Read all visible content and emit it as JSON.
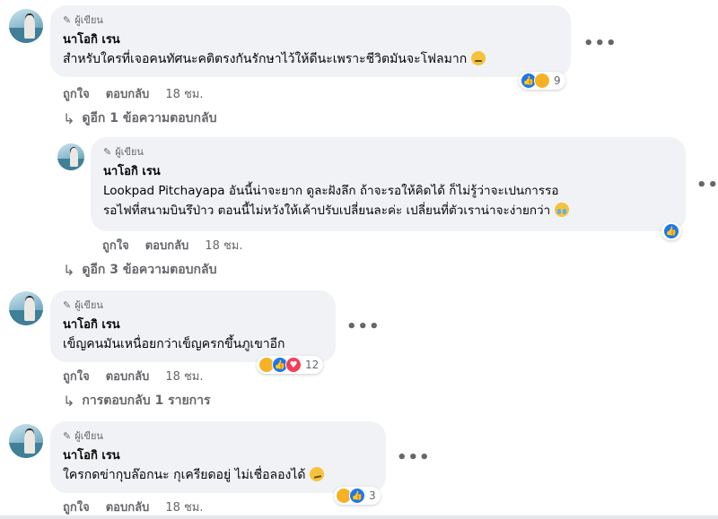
{
  "comments": [
    {
      "badge": "ผู้เขียน",
      "author": "นาโอกิ เรน",
      "text": "สำหรับใครที่เจอคนทัศนะคติตรงกันรักษาไว้ให้ดีนะเพราะชีวิตมันจะโฟลมาก",
      "emoji": "pensive-face",
      "reactions": {
        "icons": [
          "like-icon",
          "care-icon"
        ],
        "count": "9"
      },
      "like_label": "ถูกใจ",
      "reply_label": "ตอบกลับ",
      "time": "18 ชม.",
      "view_replies": "ดูอีก 1 ข้อความตอบกลับ"
    },
    {
      "badge": "ผู้เขียน",
      "author": "นาโอกิ เรน",
      "text_line1": "Lookpad Pitchayapa อันนี้น่าจะยาก ดูละฝังลึก ถ้าจะรอให้คิดได้ ก็ไม่รู้ว่าจะเปนการรอ",
      "text_line2": "รอไฟที่สนามบินรึป่าว ตอนนี้ไม่หวังให้เค้าปรับเปลี่ยนละค่ะ เปลี่ยนที่ตัวเราน่าจะง่ายกว่า",
      "emoji": "crying-face",
      "reactions": {
        "icons": [
          "like-icon"
        ],
        "count": ""
      },
      "like_label": "ถูกใจ",
      "reply_label": "ตอบกลับ",
      "time": "18 ชม.",
      "view_replies": "ดูอีก 3 ข้อความตอบกลับ"
    },
    {
      "badge": "ผู้เขียน",
      "author": "นาโอกิ เรน",
      "text": "เข็ญคนมันเหนื่อยกว่าเข็ญครกขึ้นภูเขาอีก",
      "reactions": {
        "icons": [
          "care-icon",
          "like-icon",
          "love-icon"
        ],
        "count": "12"
      },
      "like_label": "ถูกใจ",
      "reply_label": "ตอบกลับ",
      "time": "18 ชม.",
      "view_replies": "การตอบกลับ 1 รายการ"
    },
    {
      "badge": "ผู้เขียน",
      "author": "นาโอกิ เรน",
      "text": "ใครกดข่ากุบล๊อกนะ กุเครียดอยู่ ไม่เชื่อลองได้",
      "emoji": "smirking-face",
      "reactions": {
        "icons": [
          "care-icon",
          "like-icon"
        ],
        "count": "3"
      },
      "like_label": "ถูกใจ",
      "reply_label": "ตอบกลับ",
      "time": "18 ชม."
    }
  ],
  "more_glyph": "•••",
  "colors": {
    "like": "#1877f2",
    "love": "#f33e58",
    "care": "#f7b125",
    "bubble": "#f0f2f5",
    "meta": "#65676b"
  }
}
